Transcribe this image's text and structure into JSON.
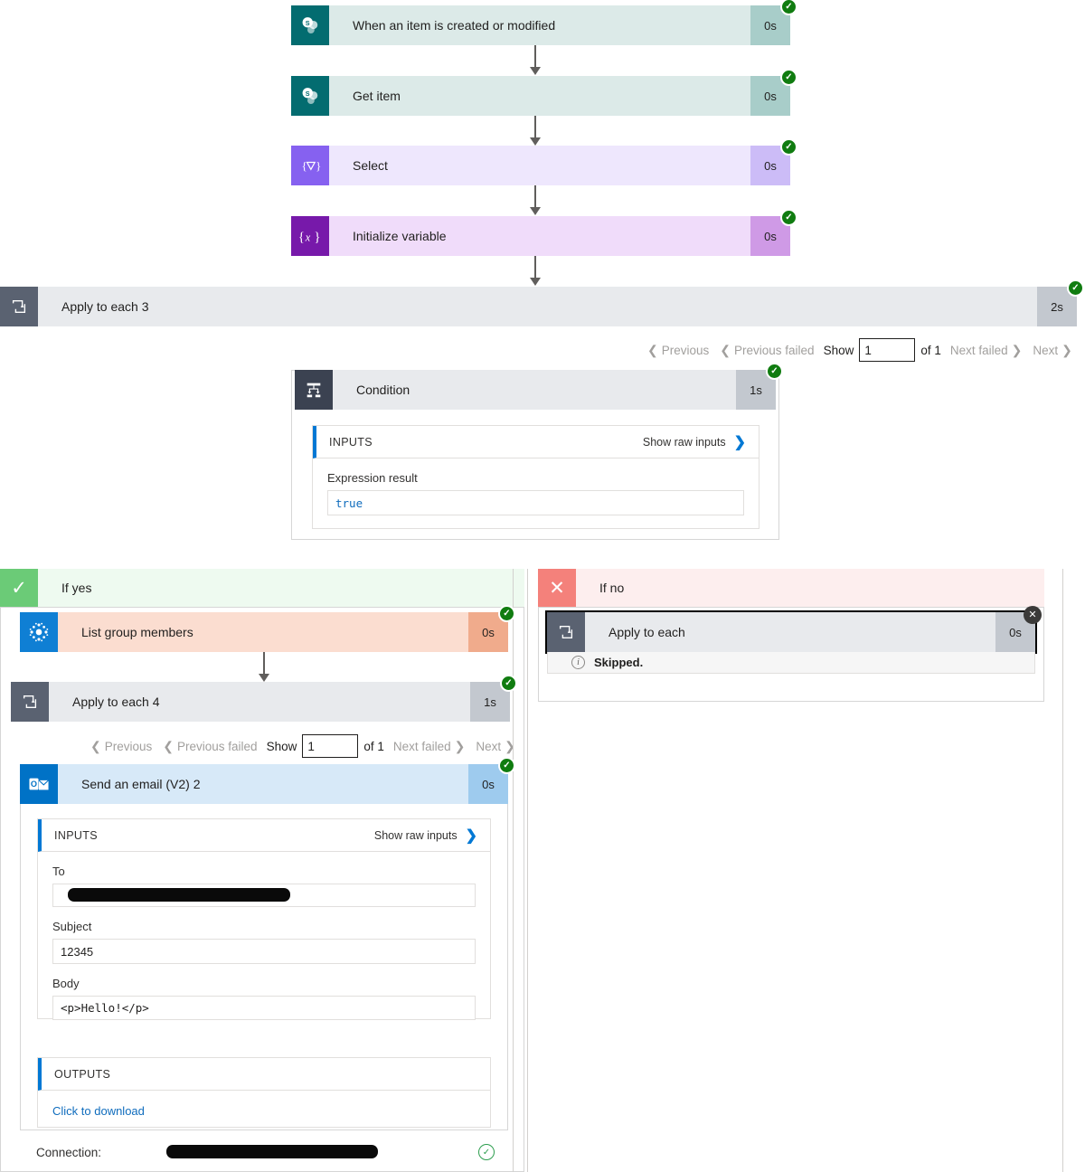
{
  "flow": {
    "steps": [
      {
        "id": "trigger",
        "label": "When an item is created or modified",
        "duration": "0s",
        "status": "succeeded",
        "icon": "sharepoint-icon"
      },
      {
        "id": "get-item",
        "label": "Get item",
        "duration": "0s",
        "status": "succeeded",
        "icon": "sharepoint-icon"
      },
      {
        "id": "select",
        "label": "Select",
        "duration": "0s",
        "status": "succeeded",
        "icon": "select-braces-icon"
      },
      {
        "id": "init-var",
        "label": "Initialize variable",
        "duration": "0s",
        "status": "succeeded",
        "icon": "variable-braces-icon"
      },
      {
        "id": "apply-each-3",
        "label": "Apply to each 3",
        "duration": "2s",
        "status": "succeeded",
        "icon": "loop-icon"
      }
    ]
  },
  "pager_outer": {
    "previous": "Previous",
    "previous_failed": "Previous failed",
    "show": "Show",
    "value": "1",
    "of": "of 1",
    "next_failed": "Next failed",
    "next": "Next"
  },
  "pager_inner": {
    "previous": "Previous",
    "previous_failed": "Previous failed",
    "show": "Show",
    "value": "1",
    "of": "of 1",
    "next_failed": "Next failed",
    "next": "Next"
  },
  "condition": {
    "label": "Condition",
    "duration": "1s",
    "status": "succeeded",
    "icon": "condition-icon",
    "inputs_title": "INPUTS",
    "show_raw": "Show raw inputs",
    "expression_label": "Expression result",
    "expression_value": "true"
  },
  "branch_yes": {
    "label": "If yes",
    "icon": "check-icon",
    "steps": [
      {
        "id": "list-group-members",
        "label": "List group members",
        "duration": "0s",
        "status": "succeeded",
        "icon": "azure-ad-icon"
      },
      {
        "id": "apply-each-4",
        "label": "Apply to each 4",
        "duration": "1s",
        "status": "succeeded",
        "icon": "loop-icon"
      },
      {
        "id": "send-email",
        "label": "Send an email (V2) 2",
        "duration": "0s",
        "status": "succeeded",
        "icon": "outlook-icon"
      }
    ],
    "email": {
      "inputs_title": "INPUTS",
      "show_raw": "Show raw inputs",
      "to_label": "To",
      "to_value": "",
      "subject_label": "Subject",
      "subject_value": "12345",
      "body_label": "Body",
      "body_value": "<p>Hello!</p>",
      "outputs_title": "OUTPUTS",
      "download_link": "Click to download",
      "connection_label": "Connection:",
      "connection_value": ""
    }
  },
  "branch_no": {
    "label": "If no",
    "icon": "close-x-icon",
    "step": {
      "id": "apply-each",
      "label": "Apply to each",
      "duration": "0s",
      "icon": "loop-icon"
    },
    "status_text": "Skipped.",
    "close_label": "✕"
  }
}
